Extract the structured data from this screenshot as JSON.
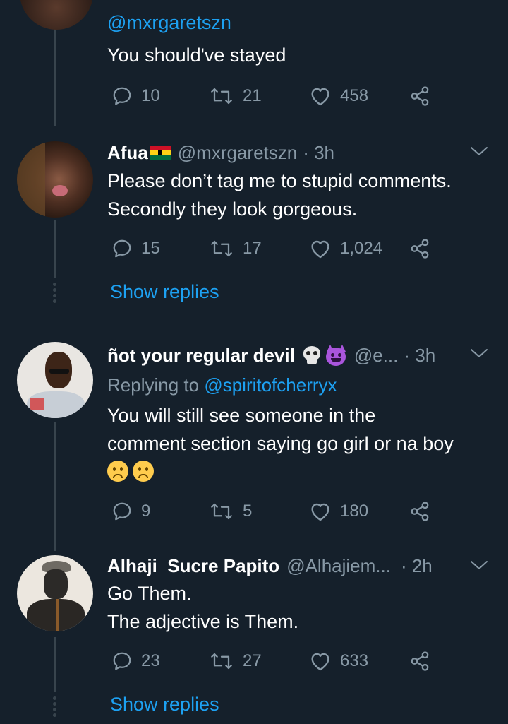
{
  "tweets": [
    {
      "handle": "@mxrgaretszn",
      "text": "You should've stayed",
      "replies": "10",
      "retweets": "21",
      "likes": "458"
    },
    {
      "name": "Afua",
      "handle": "@mxrgaretszn",
      "time": "· 3h",
      "text_line1": "Please don’t tag me to stupid comments.",
      "text_line2": "Secondly they look gorgeous.",
      "replies": "15",
      "retweets": "17",
      "likes": "1,024",
      "show_replies": "Show replies"
    },
    {
      "name": "ñot your regular devil",
      "handle": "@e...",
      "time": "· 3h",
      "replying_label": "Replying to",
      "replying_to": "@spiritofcherryx",
      "text_line1": "You will still see someone in the",
      "text_line2": "comment section saying go girl or na boy",
      "replies": "9",
      "retweets": "5",
      "likes": "180"
    },
    {
      "name": "Alhaji_Sucre Papito",
      "handle": "@Alhajiem...",
      "time": "· 2h",
      "text_line1": "Go Them.",
      "text_line2": "The adjective is Them.",
      "replies": "23",
      "retweets": "27",
      "likes": "633",
      "show_replies": "Show replies"
    }
  ],
  "icons": {
    "reply": "reply-icon",
    "retweet": "retweet-icon",
    "like": "heart-icon",
    "share": "share-icon",
    "more": "chevron-down-icon"
  },
  "colors": {
    "background": "#15202b",
    "accent": "#1da1f2",
    "secondary_text": "#8899a6",
    "border": "#38444d"
  }
}
